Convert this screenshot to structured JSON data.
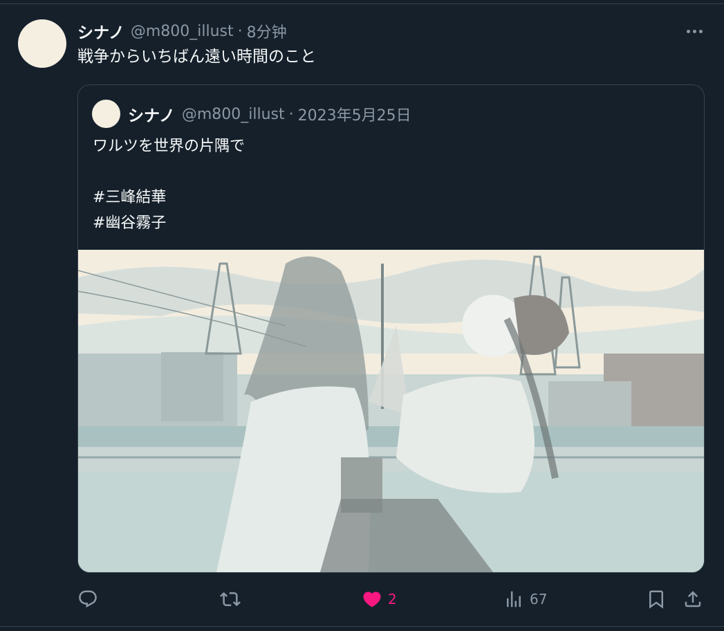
{
  "tweet": {
    "author_name": "シナノ",
    "handle": "@m800_illust",
    "separator": "·",
    "time": "8分钟",
    "text": "戦争からいちばん遠い時間のこと"
  },
  "quoted": {
    "author_name": "シナノ",
    "handle": "@m800_illust",
    "separator": "·",
    "date": "2023年5月25日",
    "lines": [
      "ワルツを世界の片隅で",
      "",
      "#三峰結華",
      "#幽谷霧子"
    ]
  },
  "actions": {
    "reply_count": "",
    "retweet_count": "",
    "like_count": "2",
    "views_count": "67"
  },
  "icons": {
    "more": "more-icon",
    "reply": "reply-icon",
    "retweet": "retweet-icon",
    "like": "heart-icon",
    "views": "views-icon",
    "bookmark": "bookmark-icon",
    "share": "share-icon"
  },
  "colors": {
    "background": "#15202b",
    "border": "#38444d",
    "muted": "#8b98a5",
    "like": "#f91880",
    "text": "#f7f9f9"
  }
}
